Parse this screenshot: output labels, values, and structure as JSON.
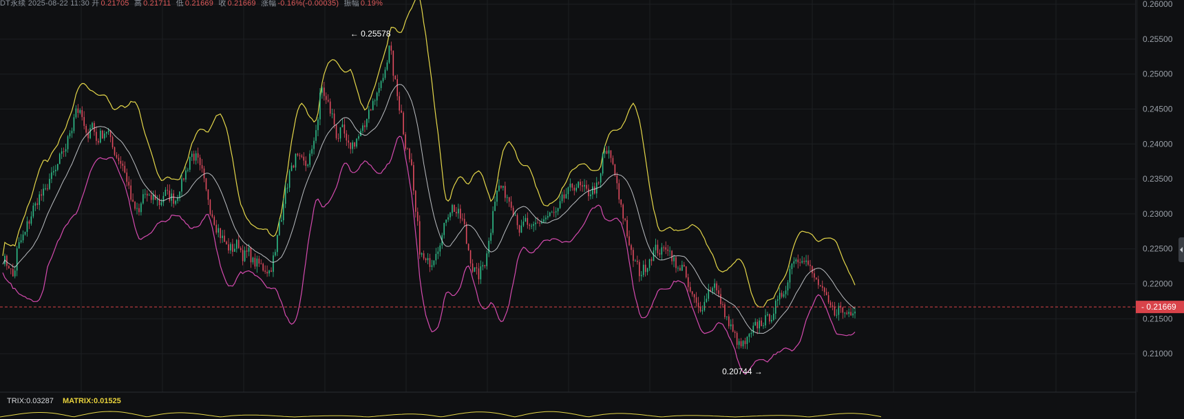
{
  "info_bar": {
    "period_label": "DT永续",
    "datetime": "2025-08-22 11:30",
    "open_label": "开",
    "open": "0.21705",
    "high_label": "高",
    "high": "0.21711",
    "low_label": "低",
    "low": "0.21669",
    "close_label": "收",
    "close": "0.21669",
    "change_label": "涨幅",
    "change": "-0.16%(-0.00035)",
    "amp_label": "振幅",
    "amp": "0.19%"
  },
  "indicator": {
    "trix_text": "TRIX:0.03287",
    "matrix_text": "MATRIX:0.01525"
  },
  "colors": {
    "background": "#0f1012",
    "grid": "#1d1f23",
    "up": "#2fbf8b",
    "down": "#e04b5f",
    "upper_band": "#e6d84a",
    "mid_band": "#d9dde2",
    "lower_band": "#d64bb0",
    "price_line": "#d9434a",
    "current_price_tag": "#d9434a"
  },
  "chart_data": {
    "type": "line",
    "description_type": "candlestick price with Bollinger-style bands",
    "y_axis_ticks": [
      "0.26000",
      "0.25500",
      "0.25000",
      "0.24500",
      "0.24000",
      "0.23500",
      "0.23000",
      "0.22500",
      "0.22000",
      "0.21500",
      "0.21000"
    ],
    "ylim": [
      0.2045,
      0.2606
    ],
    "current_price": "0.21669",
    "annotations": [
      {
        "label": "0.25578",
        "value": 0.25578,
        "position_fraction": 0.312
      },
      {
        "label": "0.20744",
        "value": 0.20744,
        "position_fraction": 0.672
      }
    ],
    "price_path": [
      0.2236,
      0.2228,
      0.221,
      0.2255,
      0.2268,
      0.229,
      0.231,
      0.2325,
      0.233,
      0.235,
      0.236,
      0.238,
      0.2395,
      0.242,
      0.2452,
      0.244,
      0.241,
      0.243,
      0.2405,
      0.2415,
      0.242,
      0.2395,
      0.238,
      0.237,
      0.234,
      0.231,
      0.23,
      0.233,
      0.232,
      0.2325,
      0.2315,
      0.233,
      0.2325,
      0.232,
      0.234,
      0.236,
      0.2385,
      0.238,
      0.236,
      0.233,
      0.23,
      0.228,
      0.2265,
      0.2252,
      0.225,
      0.2258,
      0.224,
      0.2245,
      0.223,
      0.2228,
      0.2222,
      0.2218,
      0.224,
      0.229,
      0.233,
      0.236,
      0.238,
      0.2375,
      0.237,
      0.2385,
      0.2425,
      0.248,
      0.246,
      0.244,
      0.241,
      0.242,
      0.2395,
      0.24,
      0.241,
      0.242,
      0.245,
      0.246,
      0.248,
      0.25,
      0.2545,
      0.249,
      0.245,
      0.24,
      0.237,
      0.23,
      0.224,
      0.223,
      0.2232,
      0.225,
      0.2268,
      0.23,
      0.231,
      0.23,
      0.229,
      0.225,
      0.222,
      0.2212,
      0.2228,
      0.226,
      0.232,
      0.234,
      0.233,
      0.232,
      0.23,
      0.2275,
      0.229,
      0.2275,
      0.2285,
      0.229,
      0.2295,
      0.23,
      0.23,
      0.232,
      0.233,
      0.234,
      0.234,
      0.2335,
      0.233,
      0.2335,
      0.234,
      0.239,
      0.2385,
      0.236,
      0.232,
      0.229,
      0.2245,
      0.223,
      0.2215,
      0.2225,
      0.224,
      0.225,
      0.2245,
      0.2255,
      0.224,
      0.2218,
      0.223,
      0.2195,
      0.218,
      0.2165,
      0.217,
      0.219,
      0.22,
      0.218,
      0.216,
      0.214,
      0.2125,
      0.211,
      0.2115,
      0.2125,
      0.214,
      0.2145,
      0.2148,
      0.2155,
      0.217,
      0.2185,
      0.22,
      0.2235,
      0.2235,
      0.224,
      0.2228,
      0.221,
      0.22,
      0.2185,
      0.217,
      0.216,
      0.2165,
      0.2158,
      0.216,
      0.2167
    ]
  }
}
